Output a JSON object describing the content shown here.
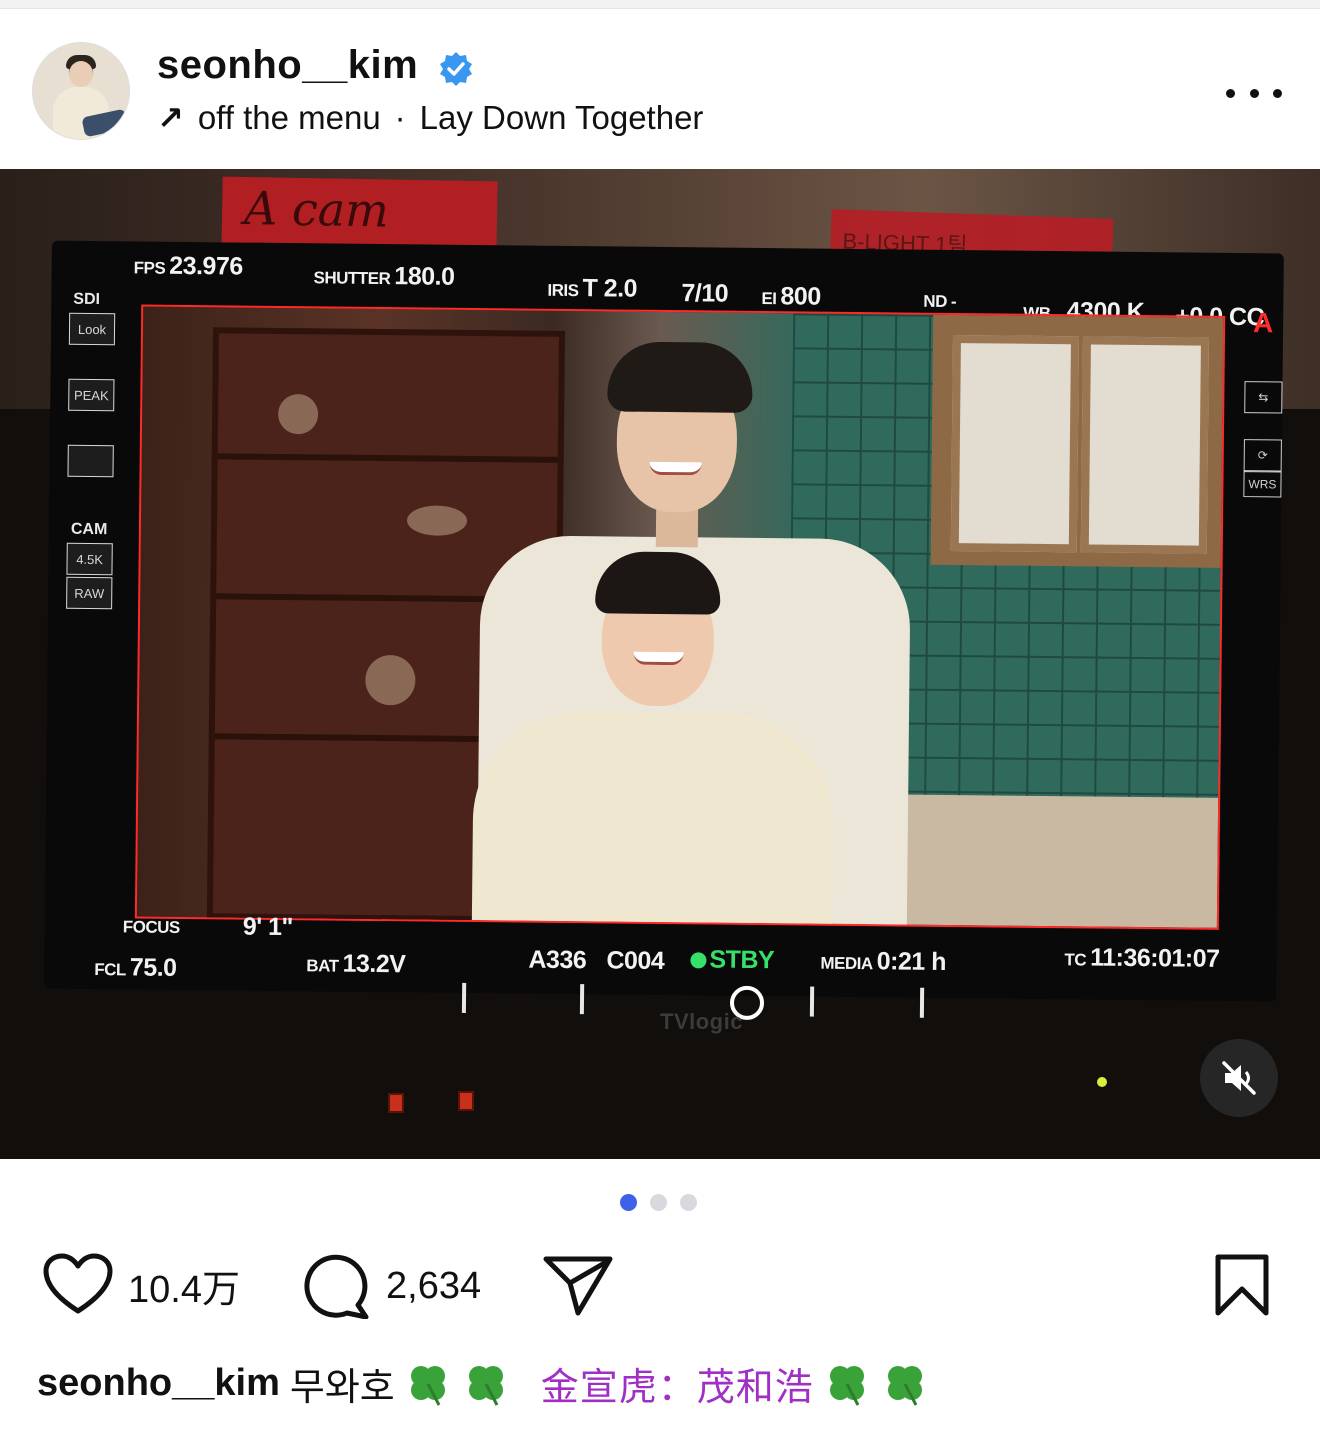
{
  "post": {
    "username": "seonho__kim",
    "verified": true,
    "music_arrow": "↗",
    "music_source": "off the menu",
    "music_separator": "·",
    "music_title": "Lay Down Together"
  },
  "monitor": {
    "tape_left": "A cam",
    "tape_right": "B-LIGHT 1팀",
    "fps_label": "FPS",
    "fps_value": "23.976",
    "shutter_label": "SHUTTER",
    "shutter_value": "180.0",
    "iris_label": "IRIS",
    "iris_value": "T 2.0",
    "iris_fraction": "7/10",
    "ei_label": "EI",
    "ei_value": "800",
    "nd_label": "ND",
    "nd_value": "-",
    "wb_label": "WB",
    "wb_value": "4300 K",
    "cc_value": "+0.0 CC",
    "record_flag": "A",
    "sdi_label": "SDI",
    "look_btn": "Look",
    "peak_btn": "PEAK",
    "cam_label": "CAM",
    "res_btn": "4.5K",
    "raw_btn": "RAW",
    "wrs_btn": "WRS",
    "focus_label": "FOCUS",
    "focus_value": "9'  1\"",
    "fcl_label": "FCL",
    "fcl_value": "75.0",
    "bat_label": "BAT",
    "bat_value": "13.2V",
    "reel": "A336",
    "clip": "C004",
    "status": "STBY",
    "media_label": "MEDIA",
    "media_value": "0:21 h",
    "tc_label": "TC",
    "tc_value": "11:36:01:07",
    "brand": "TVlogic"
  },
  "pager": {
    "total": 3,
    "active": 1
  },
  "actions": {
    "likes": "10.4万",
    "comments": "2,634"
  },
  "caption": {
    "username": "seonho__kim",
    "korean": "무와호",
    "chinese": "金宣虎：茂和浩"
  },
  "colors": {
    "verified_blue": "#3897f0",
    "pager_active": "#3f61e8",
    "caption_purple": "#a12ec5",
    "standby_green": "#36e06a",
    "frame_red": "#ff2a2a"
  },
  "icons": [
    "verified-badge-icon",
    "music-arrow-icon",
    "more-options-icon",
    "mute-icon",
    "heart-icon",
    "comment-icon",
    "share-icon",
    "bookmark-icon",
    "clover-icon"
  ]
}
